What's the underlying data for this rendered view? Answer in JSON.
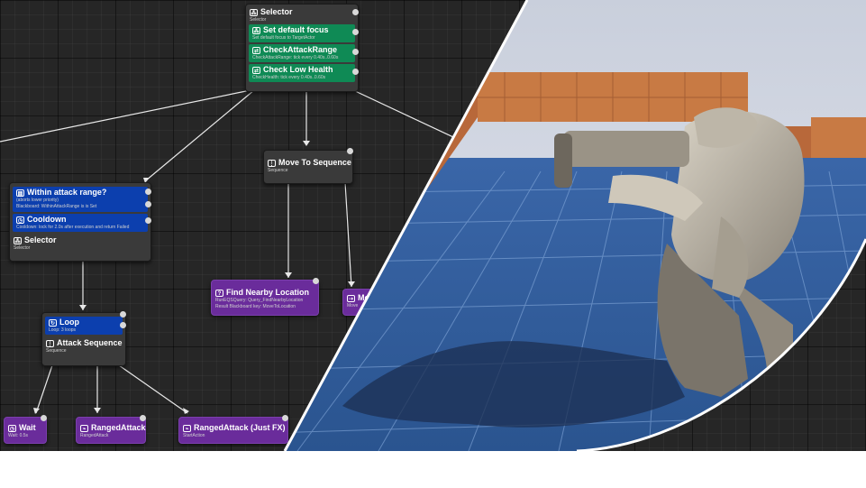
{
  "nodes": {
    "root": {
      "title": "Selector",
      "subtitle": "Selector"
    },
    "set_focus": {
      "title": "Set default focus",
      "subtitle": "Set default focus to TargetActor"
    },
    "check_range": {
      "title": "CheckAttackRange",
      "subtitle": "CheckAttackRange: tick every 0.40s..0.60s"
    },
    "check_health": {
      "title": "Check Low Health",
      "subtitle": "CheckHealth: tick every 0.40s..0.60s"
    },
    "within": {
      "title": "Within attack range?",
      "subtitle1": "(aborts lower priority)",
      "subtitle2": "Blackboard: WithinAttackRange is is Set"
    },
    "cooldown": {
      "title": "Cooldown",
      "subtitle": "Cooldown: lock for 2.0s after execution and return Failed"
    },
    "selector2": {
      "title": "Selector",
      "subtitle": "Selector"
    },
    "move_seq": {
      "title": "Move To Sequence",
      "subtitle": "Sequence"
    },
    "find_nearby": {
      "title": "Find Nearby Location",
      "subtitle1": "RunEQSQuery: Query_FindNearbyLocation",
      "subtitle2": "Result Blackboard key: MoveToLocation"
    },
    "move_to": {
      "title": "Mo",
      "subtitle": "Move"
    },
    "loop": {
      "title": "Loop",
      "subtitle": "Loop: 3 loops"
    },
    "attack_seq": {
      "title": "Attack Sequence",
      "subtitle": "Sequence"
    },
    "wait": {
      "title": "Wait",
      "subtitle": "Wait: 0.5s"
    },
    "ranged": {
      "title": "RangedAttack",
      "subtitle": "RangedAttack"
    },
    "ranged_fx": {
      "title": "RangedAttack (Just FX)",
      "subtitle": "StartAction"
    }
  },
  "colors": {
    "decorator_green": "#0f8a55",
    "decorator_blue": "#0c3fae",
    "task_purple": "#6a2c9b",
    "sky": "#d6dbe6",
    "floor": "#2f5a9c"
  },
  "viewport": {
    "description_icon": "robot-with-launcher-icon"
  }
}
